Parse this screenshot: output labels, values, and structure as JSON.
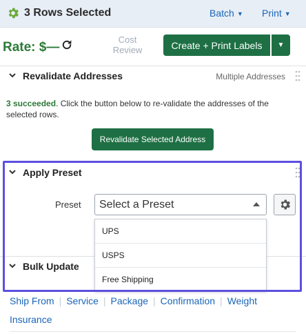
{
  "header": {
    "title": "3 Rows Selected",
    "batch_label": "Batch",
    "print_label": "Print"
  },
  "rate": {
    "label": "Rate: $—",
    "cost_review_line1": "Cost",
    "cost_review_line2": "Review",
    "create_button": "Create + Print Labels"
  },
  "revalidate": {
    "title": "Revalidate Addresses",
    "meta": "Multiple Addresses",
    "succeeded": "3 succeeded",
    "message": ". Click the button below to re-validate the addresses of the selected rows.",
    "button": "Revalidate Selected Address"
  },
  "preset": {
    "title": "Apply Preset",
    "label": "Preset",
    "selected": "Select a Preset",
    "options": [
      "UPS",
      "USPS",
      "Free Shipping"
    ]
  },
  "bulk": {
    "title": "Bulk Update",
    "links": [
      "Ship From",
      "Service",
      "Package",
      "Confirmation",
      "Weight",
      "Insurance"
    ]
  },
  "colors": {
    "accent_green": "#1e7044",
    "link_blue": "#1a65b7",
    "highlight": "#5b4fe0"
  }
}
